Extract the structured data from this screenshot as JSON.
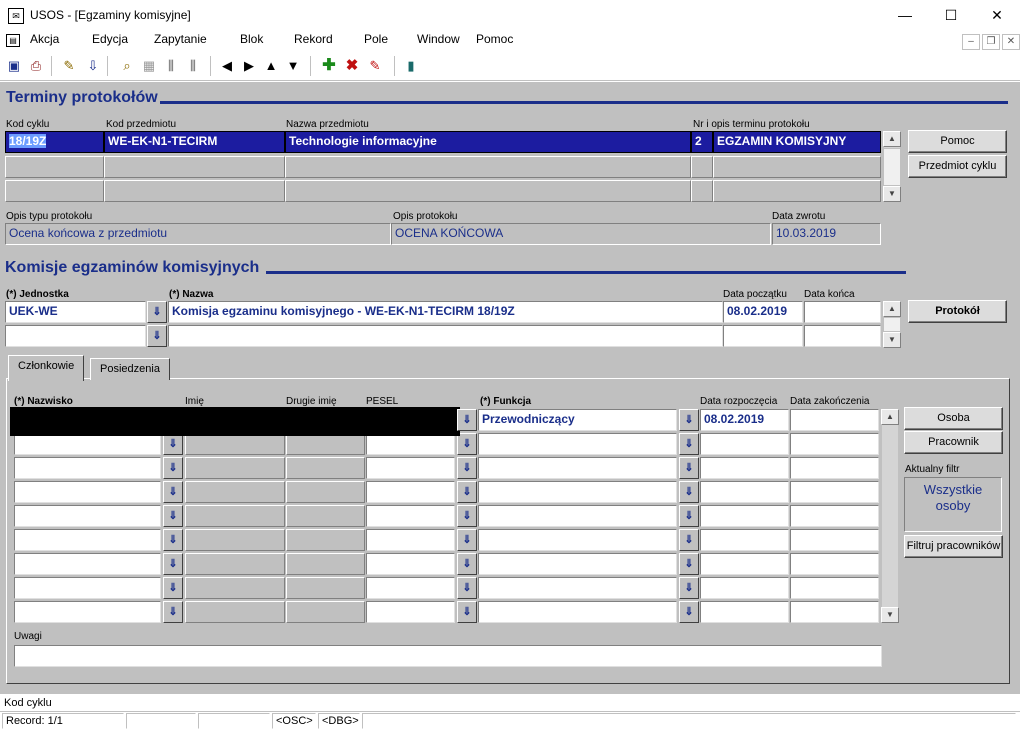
{
  "window": {
    "title": "USOS - [Egzaminy komisyjne]",
    "minimize": "—",
    "maximize": "☐",
    "close": "✕"
  },
  "menu": {
    "items": [
      "Akcja",
      "Edycja",
      "Zapytanie",
      "Blok",
      "Rekord",
      "Pole",
      "Window",
      "Pomoc"
    ]
  },
  "terminy": {
    "title": "Terminy protokołów",
    "labels": {
      "kod_cyklu": "Kod cyklu",
      "kod_przedmiotu": "Kod przedmiotu",
      "nazwa_przedmiotu": "Nazwa przedmiotu",
      "nr_opis": "Nr i opis terminu protokołu",
      "opis_typu": "Opis typu protokołu",
      "opis_protokolu": "Opis protokołu",
      "data_zwrotu": "Data zwrotu"
    },
    "row": {
      "kod_cyklu": "18/19Z",
      "kod_przedmiotu": "WE-EK-N1-TECIRM",
      "nazwa_przedmiotu": "Technologie informacyjne",
      "nr": "2",
      "opis": "EGZAMIN KOMISYJNY"
    },
    "opis_typu": "Ocena końcowa z przedmiotu",
    "opis_protokolu": "OCENA KOŃCOWA",
    "data_zwrotu": "10.03.2019",
    "buttons": {
      "pomoc": "Pomoc",
      "przedmiot_cyklu": "Przedmiot cyklu"
    }
  },
  "komisje": {
    "title": "Komisje egzaminów komisyjnych",
    "labels": {
      "jednostka": "(*) Jednostka",
      "nazwa": "(*) Nazwa",
      "data_poczatku": "Data początku",
      "data_konca": "Data końca"
    },
    "row": {
      "jednostka": "UEK-WE",
      "nazwa": "Komisja egzaminu komisyjnego - WE-EK-N1-TECIRM 18/19Z",
      "data_poczatku": "08.02.2019",
      "data_konca": ""
    },
    "protokol_button": "Protokół"
  },
  "tabs": [
    "Członkowie",
    "Posiedzenia"
  ],
  "czlonkowie": {
    "labels": {
      "nazwisko": "(*) Nazwisko",
      "imie": "Imię",
      "drugie_imie": "Drugie imię",
      "pesel": "PESEL",
      "funkcja": "(*) Funkcja",
      "data_rozpoczecia": "Data rozpoczęcia",
      "data_zakonczenia": "Data zakończenia"
    },
    "first_row": {
      "funkcja": "Przewodniczący",
      "data_rozpoczecia": "08.02.2019",
      "data_zakonczenia": ""
    },
    "buttons": {
      "osoba": "Osoba",
      "pracownik": "Pracownik",
      "filtruj": "Filtruj pracowników"
    },
    "filter_label": "Aktualny filtr",
    "filter_value": "Wszystkie osoby",
    "uwagi_label": "Uwagi",
    "uwagi_value": ""
  },
  "status": {
    "hint": "Kod cyklu",
    "record": "Record: 1/1",
    "osc": "<OSC>",
    "dbg": "<DBG>"
  },
  "lov_glyph": "⇓"
}
